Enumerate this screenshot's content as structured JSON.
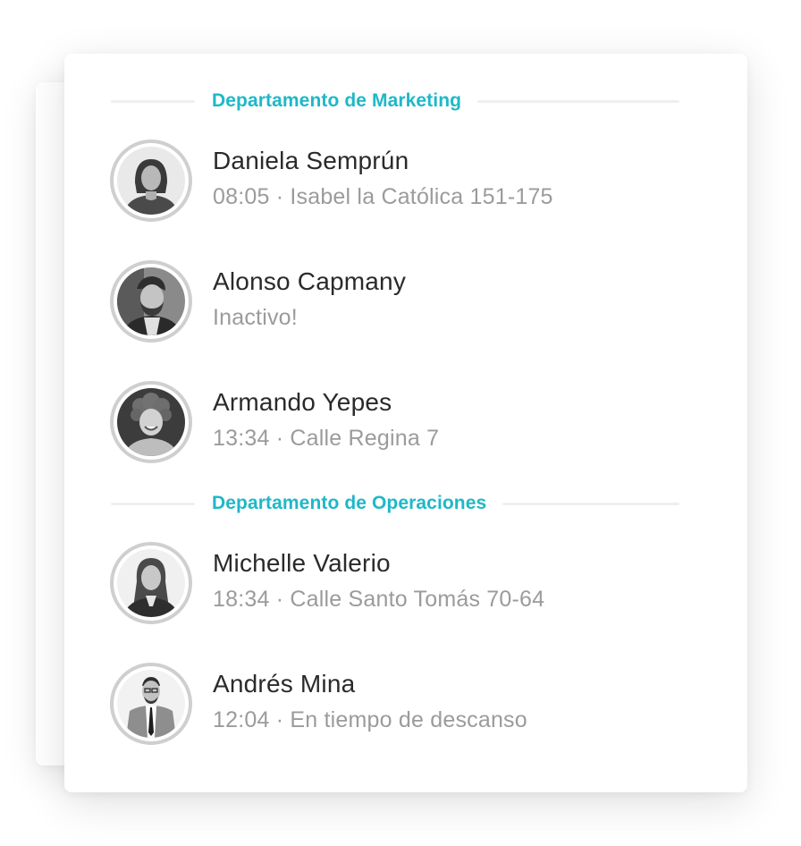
{
  "sections": [
    {
      "title": "Departamento de Marketing",
      "people": [
        {
          "name": "Daniela Semprún",
          "status": "08:05 · Isabel la Católica 151-175",
          "avatar": "woman-avatar-icon"
        },
        {
          "name": "Alonso Capmany",
          "status": "Inactivo!",
          "avatar": "man-beard-avatar-icon"
        },
        {
          "name": "Armando Yepes",
          "status": "13:34 · Calle Regina 7",
          "avatar": "man-curly-avatar-icon"
        }
      ]
    },
    {
      "title": "Departamento de Operaciones",
      "people": [
        {
          "name": "Michelle Valerio",
          "status": "18:34 · Calle Santo Tomás 70-64",
          "avatar": "woman-long-hair-avatar-icon"
        },
        {
          "name": "Andrés Mina",
          "status": "12:04 · En tiempo de descanso",
          "avatar": "man-suit-avatar-icon"
        }
      ]
    }
  ],
  "colors": {
    "accent": "#1eb8c8",
    "name_text": "#2a2a2a",
    "status_text": "#9b9b9b",
    "avatar_ring": "#cfcfcf",
    "divider": "#efefef"
  }
}
